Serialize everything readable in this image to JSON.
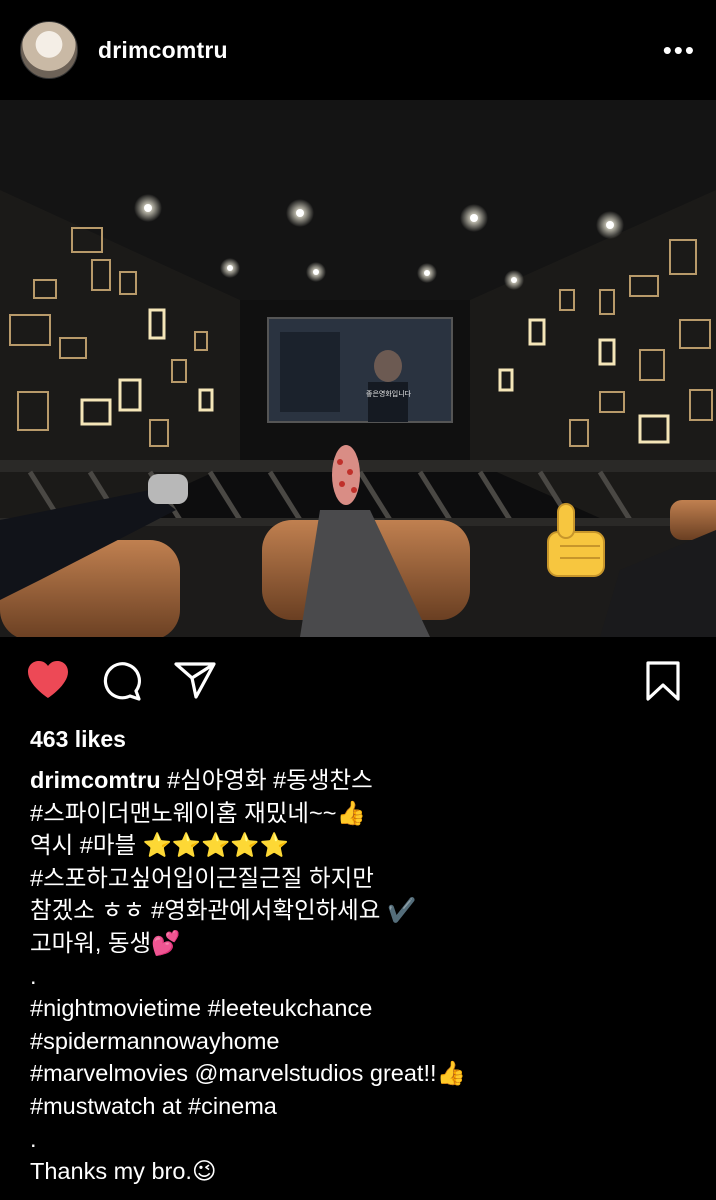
{
  "header": {
    "username": "drimcomtru",
    "more_label": "•••"
  },
  "post": {
    "photo_screen_text": "좋은영화입니다"
  },
  "actions": {
    "like_color": "#ed4956"
  },
  "likes": "463 likes",
  "caption": {
    "username": "drimcomtru",
    "lines": [
      " #심야영화 #동생찬스",
      "#스파이더맨노웨이홈 재밌네~~👍",
      "역시 #마블 ⭐⭐⭐⭐⭐",
      "#스포하고싶어입이근질근질 하지만",
      "참겠소 ㅎㅎ #영화관에서확인하세요 ✔️",
      "고마워, 동생💕",
      ".",
      "#nightmovietime #leeteukchance",
      "#spidermannowayhome",
      "#marvelmovies @marvelstudios great!!👍",
      "#mustwatch at #cinema",
      ".",
      "Thanks my bro.😉"
    ]
  }
}
